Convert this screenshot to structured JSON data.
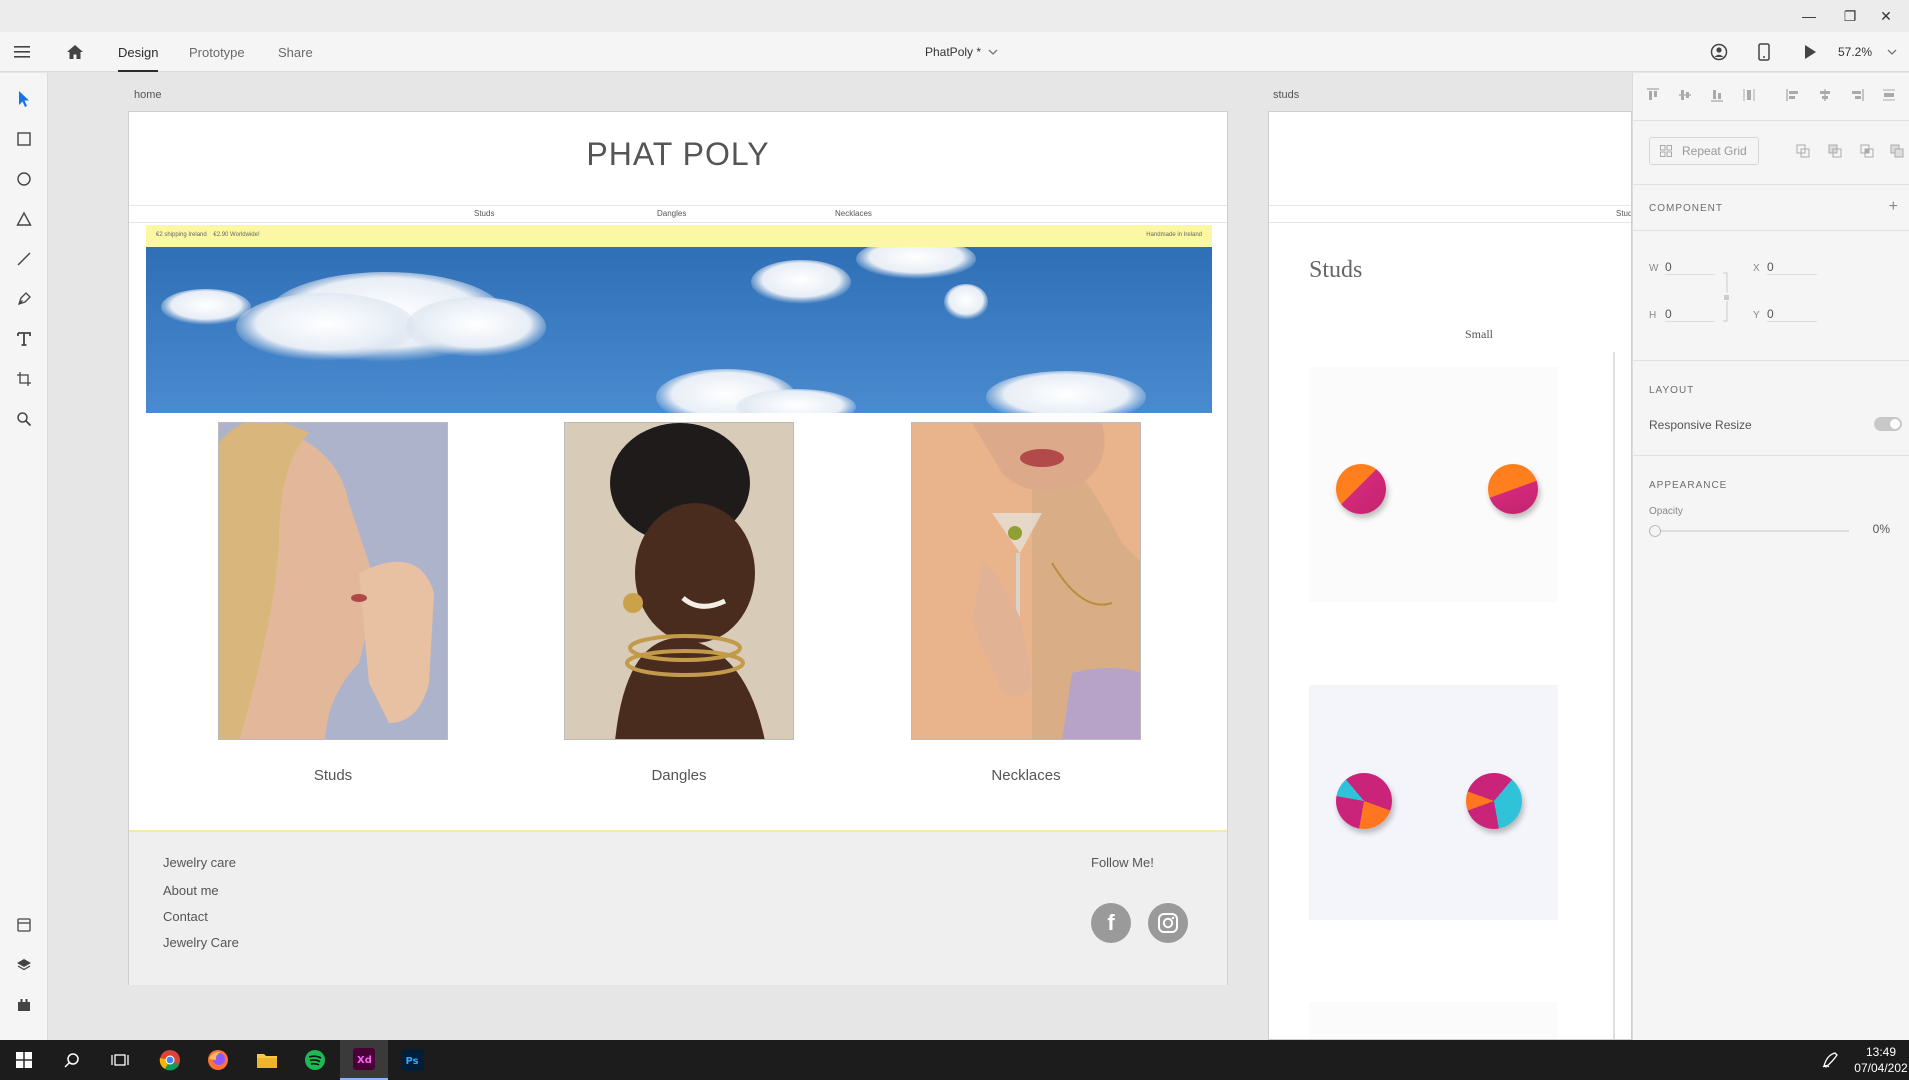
{
  "window": {
    "minimize": "—",
    "restore": "❐",
    "close": "✕"
  },
  "header": {
    "tabs": [
      {
        "label": "Design"
      },
      {
        "label": "Prototype"
      },
      {
        "label": "Share"
      }
    ],
    "doc_title": "PhatPoly *",
    "zoom": "57.2%"
  },
  "artboards": {
    "home": {
      "label": "home",
      "title": "PHAT POLY",
      "nav": [
        "Studs",
        "Dangles",
        "Necklaces"
      ],
      "shipping": "€2 shipping Ireland    €2.90 Worldwide!",
      "handmade": "Handmade in Ireland",
      "products": [
        {
          "label": "Studs"
        },
        {
          "label": "Dangles"
        },
        {
          "label": "Necklaces"
        }
      ],
      "footer": {
        "links": [
          "Jewelry care",
          "About me",
          "Contact",
          "Jewelry Care"
        ],
        "follow": "Follow Me!",
        "facebook": "f"
      }
    },
    "studs": {
      "label": "studs",
      "nav_partial": "Stud",
      "heading": "Studs",
      "size_label": "Small"
    }
  },
  "right_panel": {
    "repeat_grid": "Repeat Grid",
    "component": "COMPONENT",
    "w_label": "W",
    "w_value": "0",
    "h_label": "H",
    "h_value": "0",
    "x_label": "X",
    "x_value": "0",
    "y_label": "Y",
    "y_value": "0",
    "layout": "LAYOUT",
    "responsive_resize": "Responsive Resize",
    "appearance": "APPEARANCE",
    "opacity_label": "Opacity",
    "opacity_value": "0%"
  },
  "taskbar": {
    "time": "13:49",
    "date": "07/04/202"
  },
  "colors": {
    "accent": "#2c2c2c",
    "select_blue": "#1473e6",
    "shipping_bar": "#fbf7a2",
    "xd_purple": "#470137",
    "ps_blue": "#001e36"
  }
}
